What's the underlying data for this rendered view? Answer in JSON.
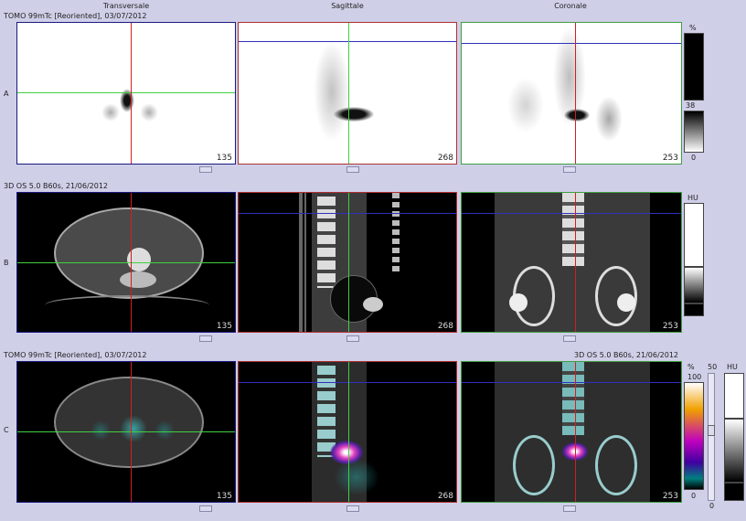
{
  "headers": {
    "transversale": "Transversale",
    "sagittale": "Sagittale",
    "coronale": "Coronale"
  },
  "rows": {
    "a": {
      "tag": "A",
      "series_title": "TOMO 99mTc [Reoriented], 03/07/2012"
    },
    "b": {
      "tag": "B",
      "series_title": "3D  OS  5.0  B60s, 21/06/2012"
    },
    "c": {
      "tag": "C",
      "series_title_left": "TOMO 99mTc [Reoriented], 03/07/2012",
      "series_title_right": "3D  OS  5.0  B60s, 21/06/2012"
    }
  },
  "slice_numbers": {
    "transversale": "135",
    "sagittale": "268",
    "coronale": "253"
  },
  "scales": {
    "a": {
      "unit": "%",
      "mid": "38",
      "min": "0"
    },
    "b": {
      "unit": "HU"
    },
    "c": {
      "unit_pct": "%",
      "max_pct": "100",
      "window": "50",
      "min_pct": "0",
      "unit_hu": "HU",
      "hu_min": "0"
    }
  },
  "colors": {
    "transversale_frame": "#1a1a80",
    "sagittale_frame": "#b03030",
    "coronale_frame": "#40a040",
    "crosshair_red": "#d02020",
    "crosshair_green": "#40d040",
    "crosshair_blue": "#3030c0"
  }
}
